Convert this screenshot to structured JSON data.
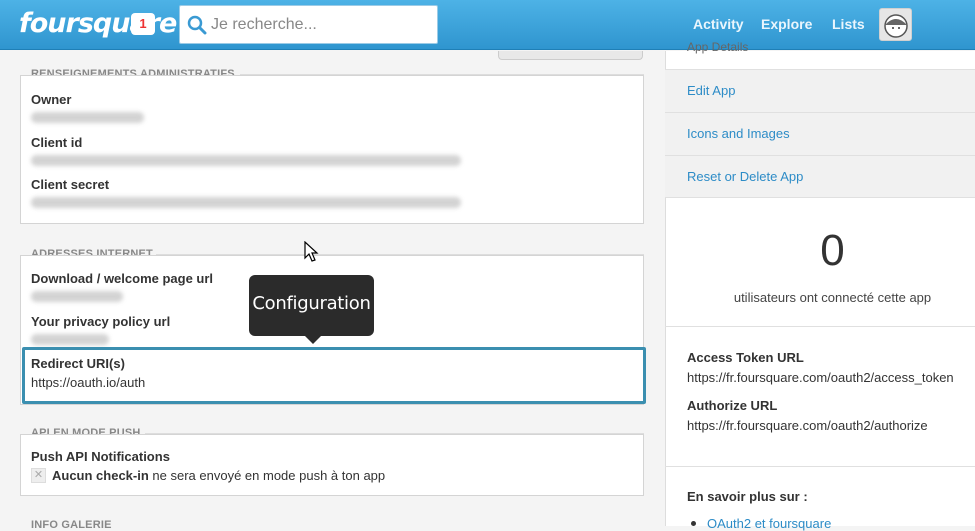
{
  "header": {
    "logo": "foursquare",
    "notifications": "1",
    "search_placeholder": "Je recherche...",
    "nav": [
      "Activity",
      "Explore",
      "Lists"
    ]
  },
  "admin": {
    "title": "RENSEIGNEMENTS ADMINISTRATIFS",
    "owner_label": "Owner",
    "client_id_label": "Client id",
    "client_secret_label": "Client secret"
  },
  "internet": {
    "title": "ADRESSES INTERNET",
    "download_label": "Download / welcome page url",
    "privacy_label": "Your privacy policy url",
    "redirect_label": "Redirect URI(s)",
    "redirect_value": "https://oauth.io/auth"
  },
  "tooltip": "Configuration",
  "push": {
    "title": "API EN MODE PUSH",
    "label": "Push API Notifications",
    "checkin_bold": "Aucun check-in",
    "checkin_rest": " ne sera envoyé en mode push à ton app"
  },
  "gallery": {
    "title": "INFO GALERIE"
  },
  "sidebar": {
    "heading": "App Details",
    "menu": [
      "Edit App",
      "Icons and Images",
      "Reset or Delete App"
    ],
    "count": "0",
    "count_label": "utilisateurs ont connecté cette app",
    "access_token_label": "Access Token URL",
    "access_token_value": "https://fr.foursquare.com/oauth2/access_token",
    "authorize_label": "Authorize URL",
    "authorize_value": "https://fr.foursquare.com/oauth2/authorize",
    "learn_more": "En savoir plus sur :",
    "link": "OAuth2 et foursquare"
  },
  "colors": {
    "accent": "#3b8fb0",
    "link": "#2d8cc7",
    "topbar": "#3ea3da"
  },
  "icons": {
    "search": "search-icon",
    "avatar": "user-avatar",
    "cursor": "mouse-pointer-icon"
  }
}
